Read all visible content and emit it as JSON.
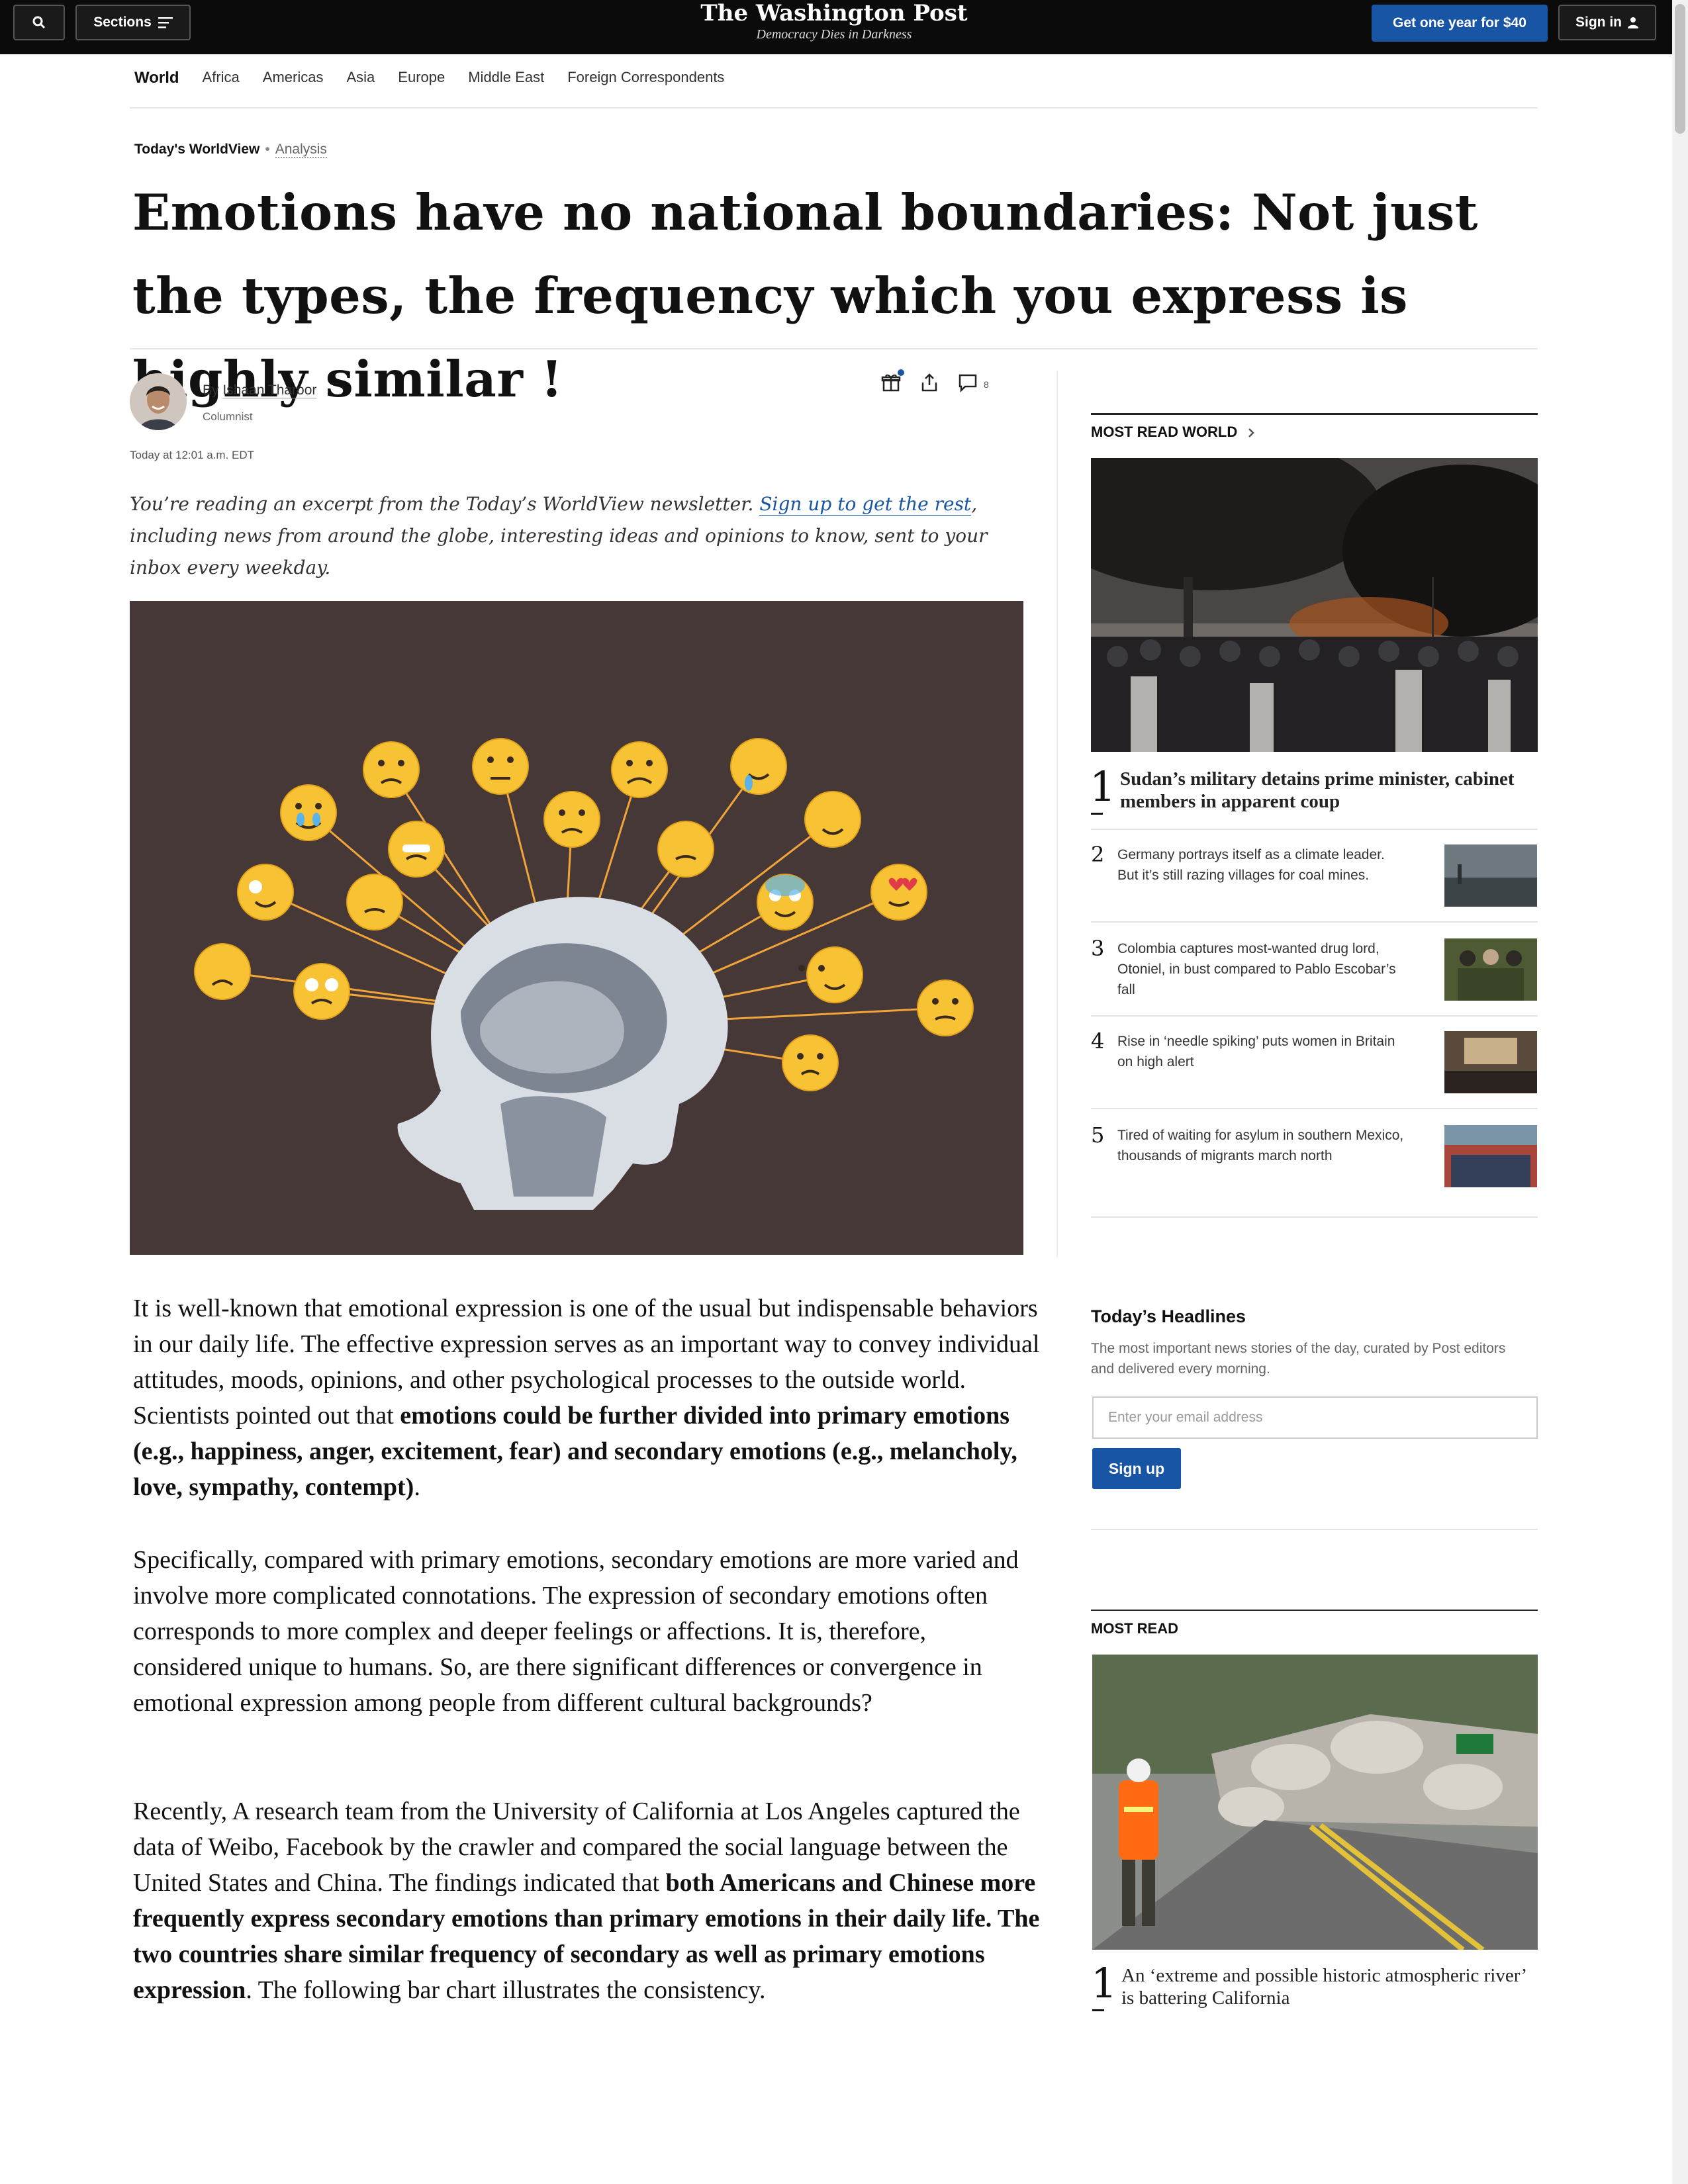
{
  "header": {
    "sections_label": "Sections",
    "logo_name": "The Washington Post",
    "logo_tagline": "Democracy Dies in Darkness",
    "subscribe_label": "Get one year for $40",
    "signin_label": "Sign in"
  },
  "subnav": [
    "World",
    "Africa",
    "Americas",
    "Asia",
    "Europe",
    "Middle East",
    "Foreign Correspondents"
  ],
  "article": {
    "kicker": "Today's WorldView",
    "kicker_type": "Analysis",
    "headline": "Emotions have no national boundaries: Not just the types, the frequency which you express is highly similar !",
    "byline_prefix": "By",
    "author": "Ishaan Tharoor",
    "author_role": "Columnist",
    "date": "Today at 12:01 a.m. EDT",
    "comments_count": "8",
    "intro_pre": "You’re reading an excerpt from the Today’s WorldView newsletter.",
    "intro_link": "Sign up to get the rest",
    "intro_post": ", including news from around the globe, interesting ideas and opinions to know, sent to your inbox every weekday.",
    "p1_text": "It is well-known that emotional expression is one of the usual but indispensable behaviors in our daily life. The effective expression serves as an important way to convey individual attitudes, moods, opinions, and other psychological processes to the outside world. Scientists pointed out that ",
    "p1_bold": "emotions could be further divided into primary emotions (e.g., happiness, anger, excitement, fear) and secondary emotions (e.g., melancholy, love, sympathy, contempt)",
    "p1_end": ".",
    "p2": "Specifically, compared with primary emotions, secondary emotions are more varied and involve more complicated connotations. The expression of secondary emotions often corresponds to more complex and deeper feelings or affections. It is, therefore, considered unique to humans. So, are there significant differences or convergence in emotional expression among people from different cultural backgrounds?",
    "p3_text": "Recently, A research team from the University of California at Los Angeles captured the data of Weibo, Facebook by the crawler and compared the social language between the United States and China. The findings indicated that ",
    "p3_bold": "both Americans and Chinese more frequently express secondary emotions than primary emotions in their daily life. The two countries share similar frequency of secondary as well as primary emotions expression",
    "p3_end": ". The following bar chart illustrates the consistency."
  },
  "most_read_world": {
    "heading": "MOST READ WORLD",
    "items": [
      {
        "rank": "1",
        "title": "Sudan’s military detains prime minister, cabinet members in apparent coup"
      },
      {
        "rank": "2",
        "title": "Germany portrays itself as a climate leader. But it’s still razing villages for coal mines."
      },
      {
        "rank": "3",
        "title": "Colombia captures most-wanted drug lord, Otoniel, in bust compared to Pablo Escobar’s fall"
      },
      {
        "rank": "4",
        "title": "Rise in ‘needle spiking’ puts women in Britain on high alert"
      },
      {
        "rank": "5",
        "title": "Tired of waiting for asylum in southern Mexico, thousands of migrants march north"
      }
    ]
  },
  "newsletter": {
    "heading": "Today’s Headlines",
    "description": "The most important news stories of the day, curated by Post editors and delivered every morning.",
    "email_placeholder": "Enter your email address",
    "signup_label": "Sign up"
  },
  "most_read": {
    "heading": "MOST READ",
    "items": [
      {
        "rank": "1",
        "title": "An ‘extreme and possible historic atmospheric river’ is battering California"
      }
    ]
  },
  "icons": [
    "search-icon",
    "menu-icon",
    "user-icon",
    "gift-icon",
    "share-icon",
    "comment-icon",
    "chevron-right-icon"
  ],
  "colors": {
    "brand_blue": "#1955a5",
    "hero_bg": "#463836",
    "emoji_yellow": "#f7c234"
  }
}
